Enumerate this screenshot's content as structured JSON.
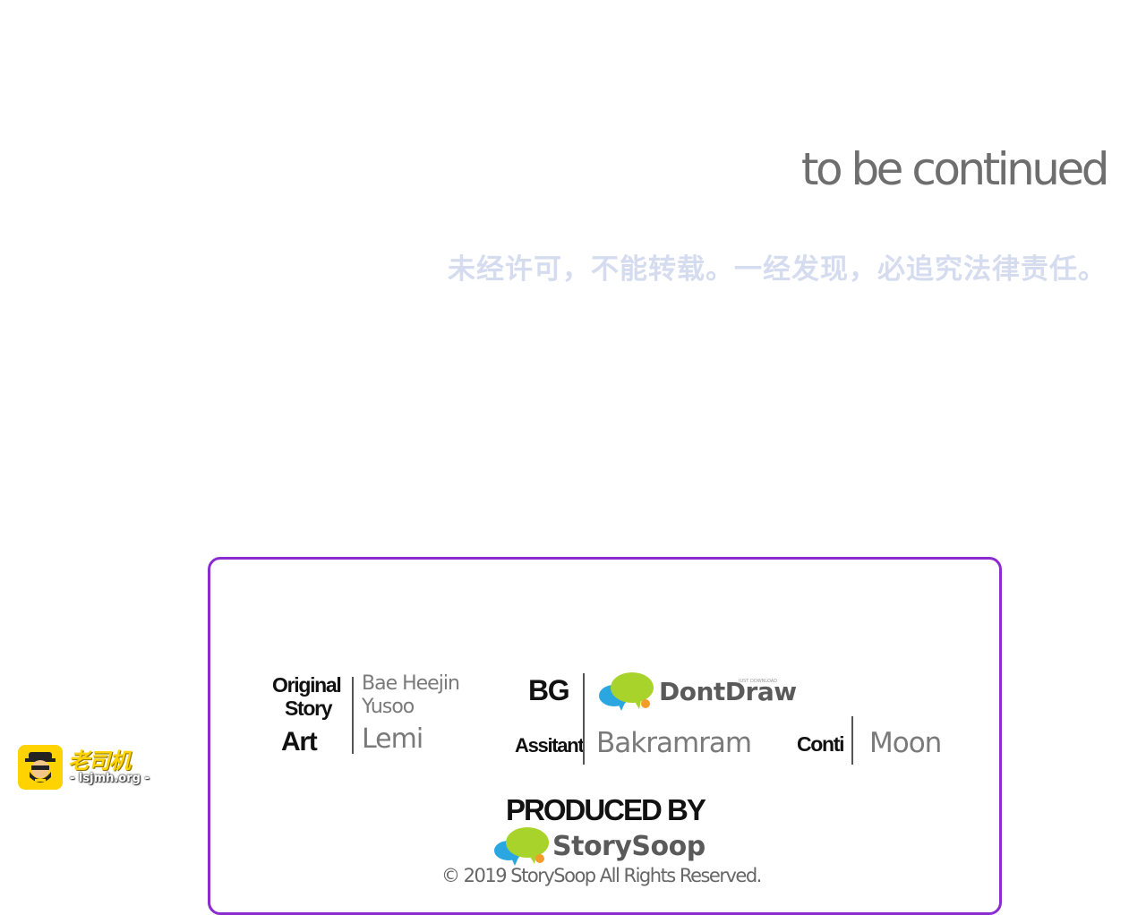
{
  "header": {
    "to_be_continued": "to be continued",
    "notice": "未经许可，不能转载。一经发现，必追究法律责任。"
  },
  "credits": {
    "original_story_label_line1": "Original",
    "original_story_label_line2": "Story",
    "original_story_value_line1": "Bae Heejin",
    "original_story_value_line2": "Yusoo",
    "art_label": "Art",
    "art_value": "Lemi",
    "bg_label": "BG",
    "bg_logo_text": "DontDraw",
    "bg_logo_tagline": "JUST DOWNLOAD",
    "assistant_label": "Assitant",
    "assistant_value": "Bakramram",
    "conti_label": "Conti",
    "conti_value": "Moon",
    "produced_by": "PRODUCED BY",
    "producer_logo_text": "StorySoop",
    "copyright": "© 2019 StorySoop All Rights Reserved."
  },
  "watermark": {
    "title": "老司机",
    "url": "- lsjmh.org -"
  },
  "colors": {
    "box_border": "#8a2ccf",
    "notice_text": "#d6dcef",
    "cloud_blue": "#2aa7e0",
    "cloud_green": "#a8d32a",
    "cloud_orange": "#f39c2a",
    "watermark_yellow": "#ffd300"
  },
  "icons": {
    "dontdraw_logo": "speech-cloud-icon",
    "storysoop_logo": "speech-cloud-icon",
    "watermark_badge": "bearded-driver-icon"
  }
}
